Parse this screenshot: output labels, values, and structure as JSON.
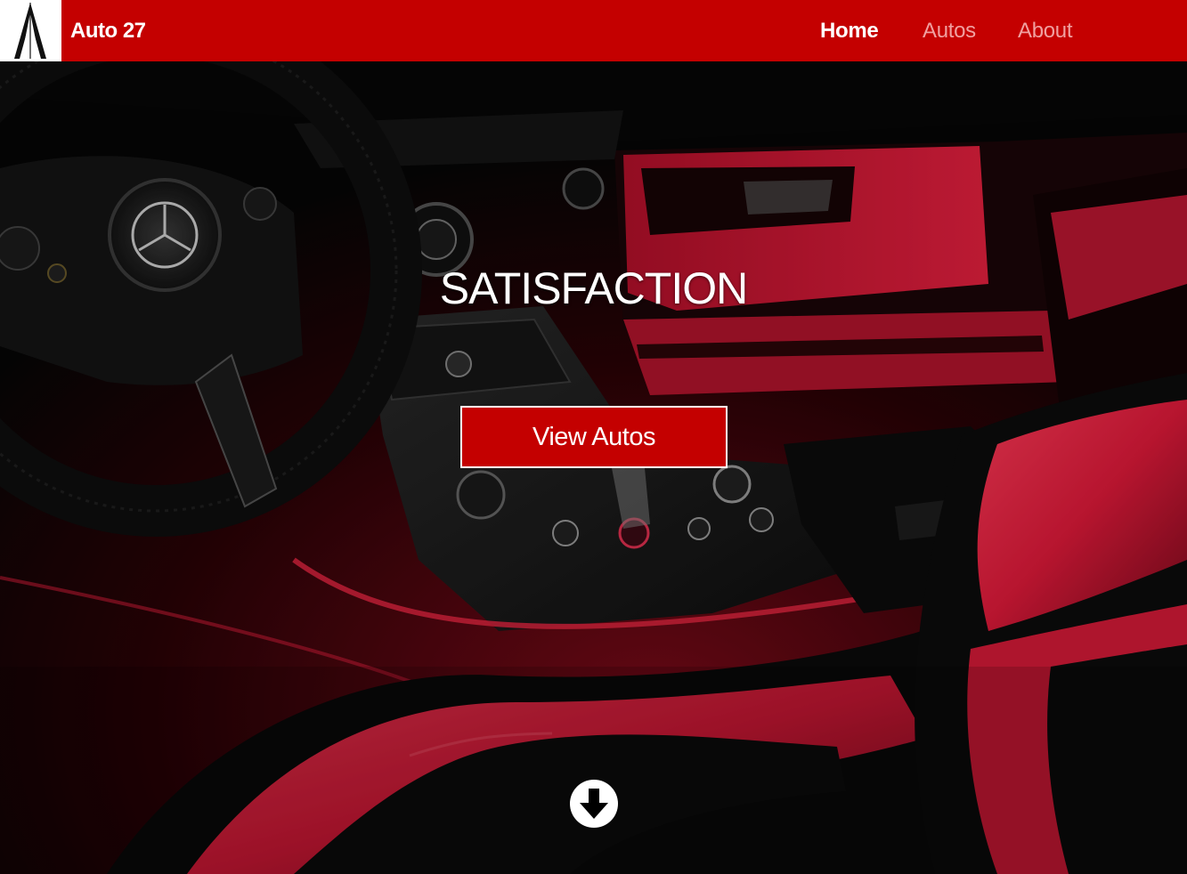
{
  "brand": {
    "logo_icon": "triangle-a-logo-icon",
    "name": "Auto 27"
  },
  "nav": {
    "items": [
      {
        "label": "Home",
        "active": true
      },
      {
        "label": "Autos",
        "active": false
      },
      {
        "label": "About",
        "active": false
      }
    ]
  },
  "hero": {
    "background": "car-interior-photo",
    "title": "SATISFACTION",
    "cta_label": "View Autos",
    "scroll_icon": "arrow-down-circle-icon"
  },
  "colors": {
    "primary_red": "#c40000",
    "nav_inactive": "#f0a0a0",
    "white": "#ffffff"
  }
}
